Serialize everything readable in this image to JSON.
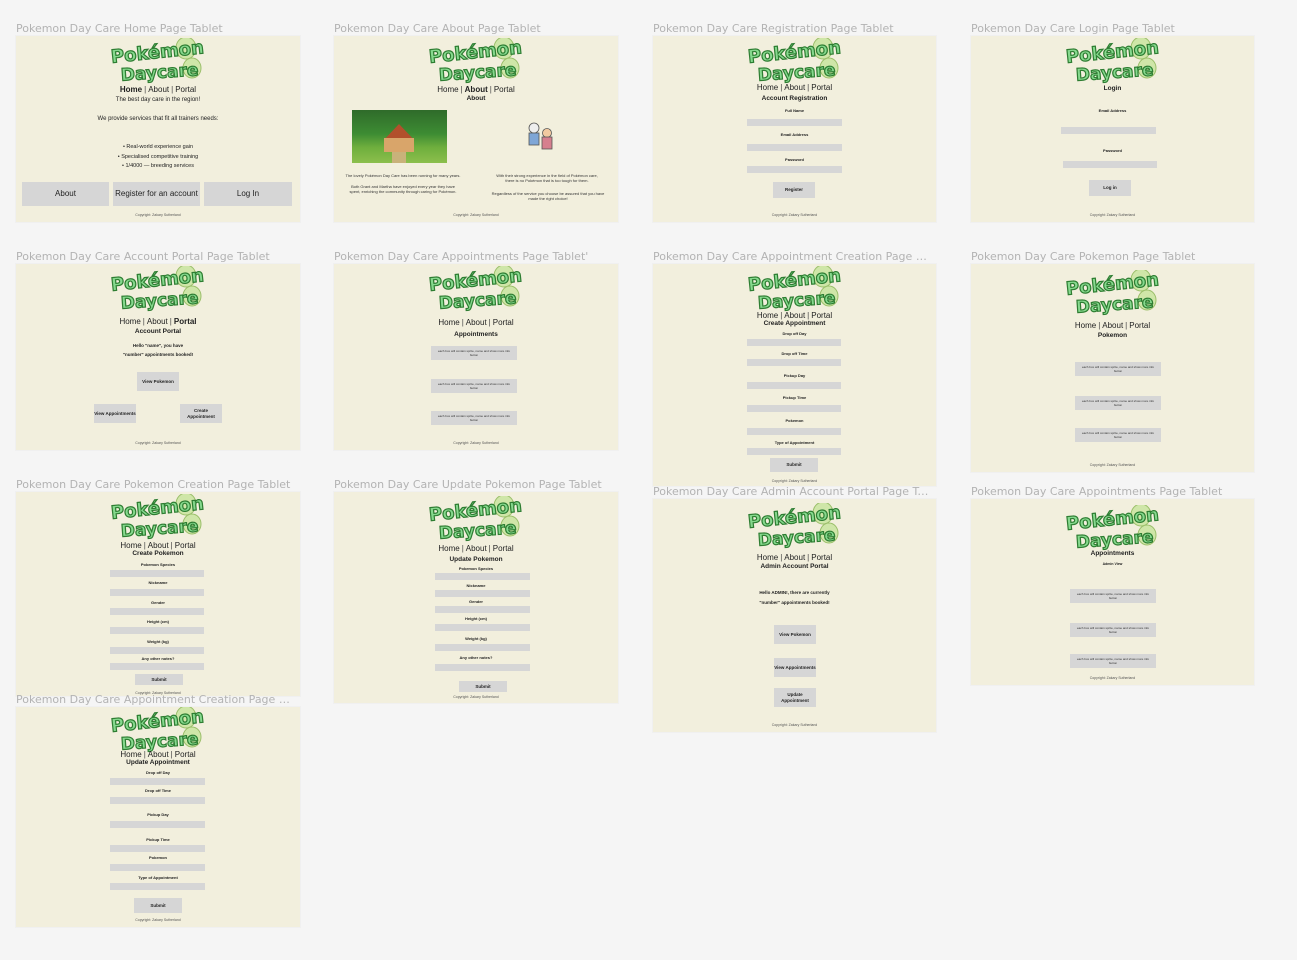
{
  "canvas_bg": "#f5f5f5",
  "frame_bg": "#f2efdd",
  "button_bg": "#d6d6d6",
  "logo": {
    "line1": "Pokémon",
    "line2": "Daycare",
    "colors": {
      "fill": "#7ed28a",
      "stroke": "#2e7d32",
      "egg": "#cfe6a8"
    }
  },
  "nav": {
    "home": "Home",
    "about": "About",
    "portal": "Portal",
    "sep": "|"
  },
  "copyright": "Copyright: Zakary Sutherland",
  "card_text": "each box will contain sprite, name and show more info button",
  "frames": {
    "home": {
      "title": "Pokemon Day Care Home Page Tablet",
      "tagline": "The best day care in the region!",
      "intro": "We provide services that fit all trainers needs:",
      "bullets": [
        "Real-world experience gain",
        "Specialised competitive training",
        "1/4000 — breeding services"
      ],
      "buttons": [
        "About",
        "Register for an account",
        "Log In"
      ]
    },
    "about": {
      "title": "Pokemon Day Care About Page Tablet",
      "heading": "About",
      "left_text_1": "The lovely Pokémon Day Care has been running for many years.",
      "left_text_2": "Both Grant and Martha have enjoyed every year they have spent, enriching the community through caring for Pokémon.",
      "right_text_1": "With their strong experience in the field of Pokémon care, there is no Pokémon that is too tough for them.",
      "right_text_2": "Regardless of the service you choose be assured that you have made the right choice!"
    },
    "registration": {
      "title": "Pokemon Day Care Registration Page Tablet",
      "heading": "Account Registration",
      "fields": [
        "Full Name",
        "Email Address",
        "Password"
      ],
      "button": "Register"
    },
    "login": {
      "title": "Pokemon Day Care Login Page Tablet",
      "heading": "Login",
      "fields": [
        "Email Address",
        "Password"
      ],
      "button": "Log in"
    },
    "portal": {
      "title": "Pokemon Day Care Account Portal Page Tablet",
      "heading": "Account Portal",
      "greeting_1": "Hello \"name\", you have",
      "greeting_2": "\"number\" appointments booked!",
      "buttons": [
        "View Pokemon",
        "View Appointments",
        "Create Appointment"
      ]
    },
    "appointments": {
      "title": "Pokemon Day Care Appointments Page Tablet'",
      "heading": "Appointments"
    },
    "appt_create": {
      "title": "Pokemon Day Care Appointment Creation Page Ta...",
      "heading": "Create Appointment",
      "fields": [
        "Drop off Day",
        "Drop off Time",
        "Pickup Day",
        "Pickup Time",
        "Pokemon",
        "Type of Appointment"
      ],
      "button": "Submit"
    },
    "pokemon": {
      "title": "Pokemon Day Care Pokemon Page Tablet",
      "heading": "Pokemon"
    },
    "poke_create": {
      "title": "Pokemon Day Care Pokemon Creation Page Tablet",
      "heading": "Create Pokemon",
      "fields": [
        "Pokemon Species",
        "Nickname",
        "Gender",
        "Height (cm)",
        "Weight (kg)",
        "Any other notes?"
      ],
      "button": "Submit"
    },
    "poke_update": {
      "title": "Pokemon Day Care Update Pokemon Page Tablet",
      "heading": "Update Pokemon",
      "fields": [
        "Pokemon Species",
        "Nickname",
        "Gender",
        "Height (cm)",
        "Weight (kg)",
        "Any other notes?"
      ],
      "button": "Submit"
    },
    "admin_portal": {
      "title": "Pokemon Day Care Admin Account Portal Page Tab...",
      "heading": "Admin Account Portal",
      "greeting_1": "Hello ADMIN!, there are currently",
      "greeting_2": "\"number\" appointments booked!",
      "buttons": [
        "View Pokemon",
        "View Appointments",
        "Update Appointment"
      ]
    },
    "admin_appointments": {
      "title": "Pokemon Day Care Appointments Page Tablet",
      "heading": "Appointments",
      "subheading": "Admin View"
    },
    "appt_update": {
      "title": "Pokemon Day Care Appointment Creation Page Ta...",
      "heading": "Update Appointment",
      "fields": [
        "Drop off Day",
        "Drop off Time",
        "Pickup Day",
        "Pickup Time",
        "Pokemon",
        "Type of Appointment"
      ],
      "button": "Submit"
    }
  }
}
